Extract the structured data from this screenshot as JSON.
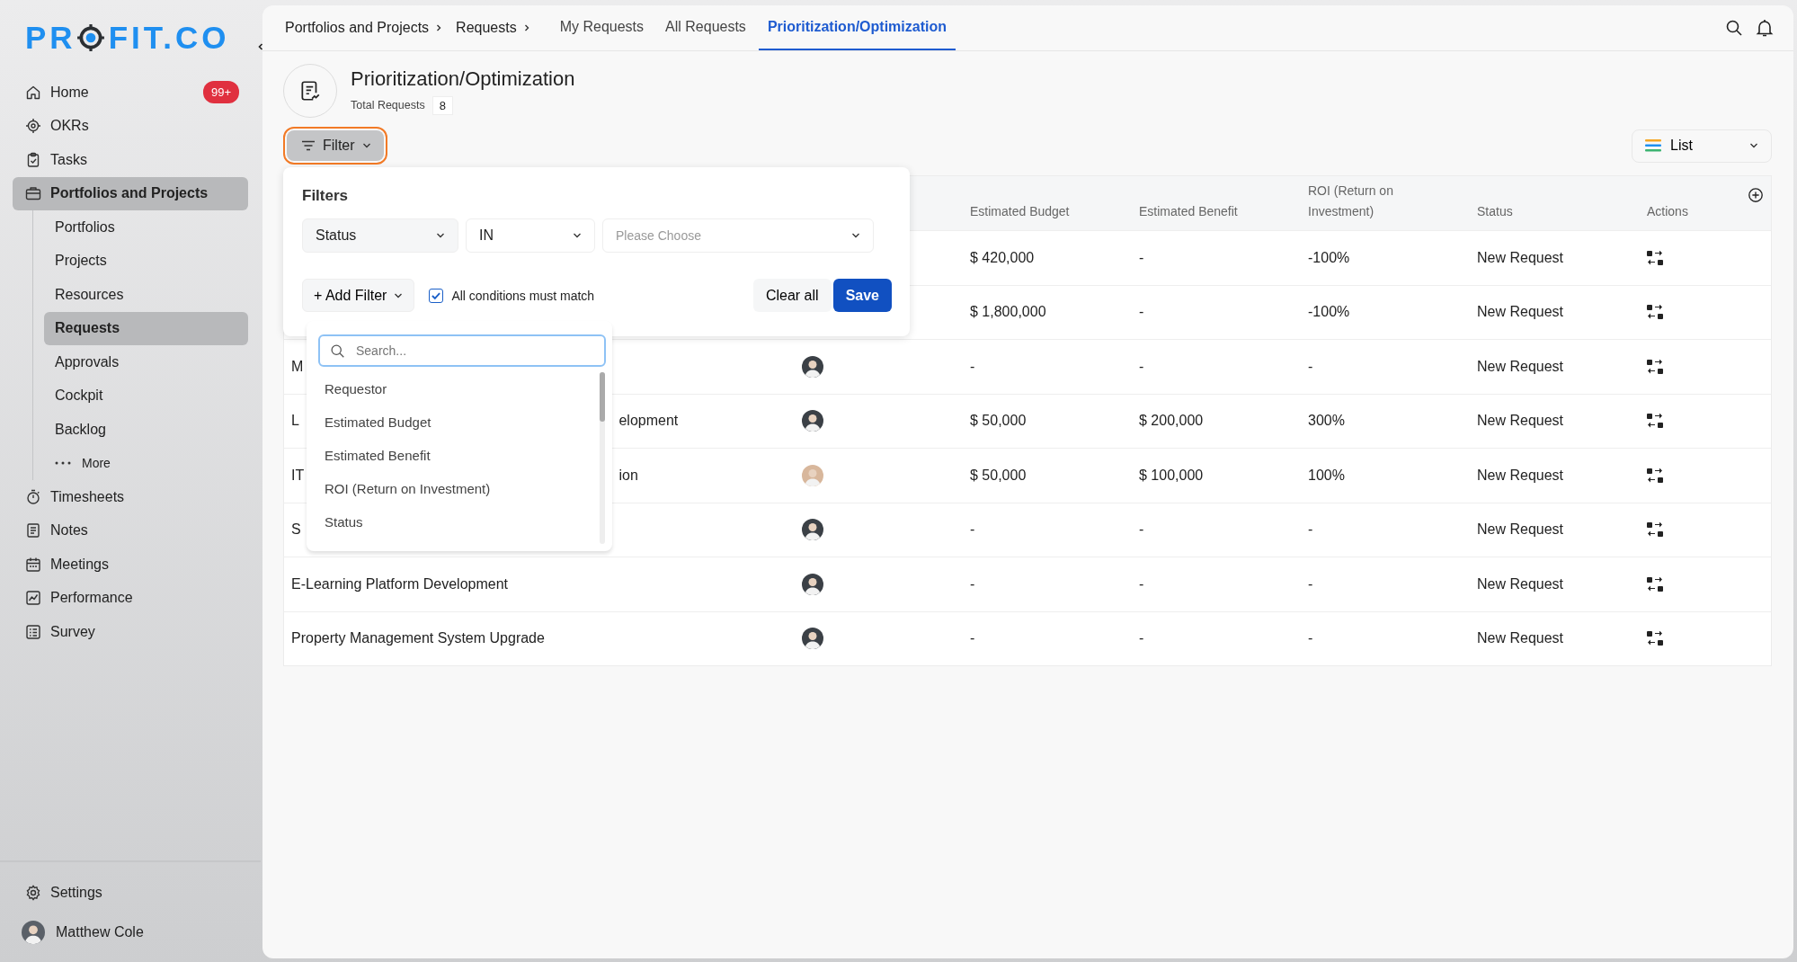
{
  "sidebar": {
    "logo": {
      "before": "PR",
      "after": "FIT.CO"
    },
    "items": [
      {
        "label": "Home",
        "badge": "99+",
        "selected": false
      },
      {
        "label": "OKRs",
        "selected": false
      },
      {
        "label": "Tasks",
        "selected": false
      },
      {
        "label": "Portfolios and Projects",
        "selected": true,
        "children": [
          {
            "label": "Portfolios",
            "selected": false
          },
          {
            "label": "Projects",
            "selected": false
          },
          {
            "label": "Resources",
            "selected": false
          },
          {
            "label": "Requests",
            "selected": true
          },
          {
            "label": "Approvals",
            "selected": false
          },
          {
            "label": "Cockpit",
            "selected": false
          },
          {
            "label": "Backlog",
            "selected": false
          },
          {
            "label": "More",
            "kind": "more",
            "selected": false
          }
        ]
      },
      {
        "label": "Timesheets",
        "selected": false
      },
      {
        "label": "Notes",
        "selected": false
      },
      {
        "label": "Meetings",
        "selected": false
      },
      {
        "label": "Performance",
        "selected": false
      },
      {
        "label": "Survey",
        "selected": false
      }
    ],
    "settings": "Settings",
    "user": {
      "name": "Matthew Cole"
    }
  },
  "breadcrumbs": [
    "Portfolios and Projects",
    "Requests"
  ],
  "tabs": [
    {
      "label": "My Requests",
      "selected": false
    },
    {
      "label": "All Requests",
      "selected": false
    },
    {
      "label": "Prioritization/Optimization",
      "selected": true
    }
  ],
  "page": {
    "title": "Prioritization/Optimization",
    "total_label": "Total Requests",
    "total": "8"
  },
  "filter_button": {
    "label": "Filter",
    "highlighted": true
  },
  "view_select": {
    "value": "List"
  },
  "table": {
    "columns": [
      "Estimated Budget",
      "Estimated Benefit",
      "ROI (Return on Investment)",
      "Status",
      "Actions"
    ],
    "rows": [
      {
        "budget": "$ 420,000",
        "benefit": "-",
        "roi": "-100%",
        "status": "New Request"
      },
      {
        "budget": "$ 1,800,000",
        "benefit": "-",
        "roi": "-100%",
        "status": "New Request"
      },
      {
        "name_head": "M",
        "requestor": {
          "color": "#3b4046"
        },
        "budget": "-",
        "benefit": "-",
        "roi": "-",
        "status": "New Request"
      },
      {
        "name_head": "L",
        "name_tail": "elopment",
        "requestor": {
          "color": "#3b4046"
        },
        "budget": "$ 50,000",
        "benefit": "$ 200,000",
        "roi": "300%",
        "status": "New Request"
      },
      {
        "name_head": "IT",
        "name_tail": "ion",
        "requestor": {
          "color": "#d8b79c"
        },
        "budget": "$ 50,000",
        "benefit": "$ 100,000",
        "roi": "100%",
        "status": "New Request"
      },
      {
        "name_head": "S",
        "requestor": {
          "color": "#3b4046"
        },
        "budget": "-",
        "benefit": "-",
        "roi": "-",
        "status": "New Request"
      },
      {
        "name_head": "E-Learning Platform Development",
        "requestor": {
          "color": "#3b4046"
        },
        "budget": "-",
        "benefit": "-",
        "roi": "-",
        "status": "New Request"
      },
      {
        "name_head": "Property Management System Upgrade",
        "requestor": {
          "color": "#3b4046"
        },
        "budget": "-",
        "benefit": "-",
        "roi": "-",
        "status": "New Request"
      }
    ]
  },
  "filter_panel": {
    "title": "Filters",
    "conditions": [
      {
        "field": "Status",
        "operator": "IN",
        "value_placeholder": "Please Choose"
      }
    ],
    "add_filter": "+ Add Filter",
    "match_all": {
      "label": "All conditions must match",
      "checked": true
    },
    "clear": "Clear all",
    "save": "Save",
    "field_menu": {
      "search_placeholder": "Search...",
      "options": [
        "Requestor",
        "Estimated Budget",
        "Estimated Benefit",
        "ROI (Return on Investment)",
        "Status"
      ]
    }
  }
}
